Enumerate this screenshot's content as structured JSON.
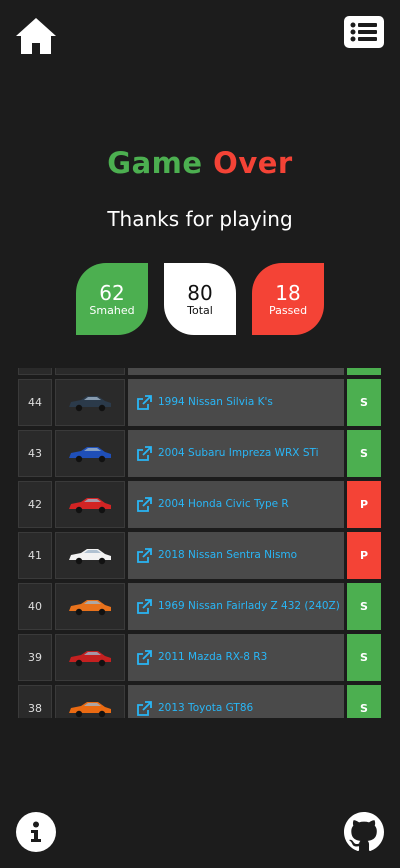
{
  "title": {
    "word1": "Game",
    "word2": "Over"
  },
  "subtitle": "Thanks for playing",
  "stats": {
    "smashed": {
      "value": "62",
      "label": "Smahed"
    },
    "total": {
      "value": "80",
      "label": "Total"
    },
    "passed": {
      "value": "18",
      "label": "Passed"
    }
  },
  "rows": [
    {
      "num": "44",
      "name": "1994 Nissan Silvia K's",
      "result": "S",
      "car_color": "#2b3a4a"
    },
    {
      "num": "43",
      "name": "2004 Subaru Impreza WRX STi",
      "result": "S",
      "car_color": "#1f4fb8"
    },
    {
      "num": "42",
      "name": "2004 Honda Civic Type R",
      "result": "P",
      "car_color": "#d32424"
    },
    {
      "num": "41",
      "name": "2018 Nissan Sentra Nismo",
      "result": "P",
      "car_color": "#f2f2f2"
    },
    {
      "num": "40",
      "name": "1969 Nissan Fairlady Z 432 (240Z)",
      "result": "S",
      "car_color": "#e8721c"
    },
    {
      "num": "39",
      "name": "2011 Mazda RX-8 R3",
      "result": "S",
      "car_color": "#c42020"
    },
    {
      "num": "38",
      "name": "2013 Toyota GT86",
      "result": "S",
      "car_color": "#ea6a12"
    }
  ],
  "icons": {
    "home": "home-icon",
    "menu": "list-icon",
    "info": "info-icon",
    "github": "github-icon",
    "link": "external-link-icon"
  },
  "colors": {
    "green": "#4caf50",
    "red": "#f44336",
    "link": "#29b6f6"
  }
}
